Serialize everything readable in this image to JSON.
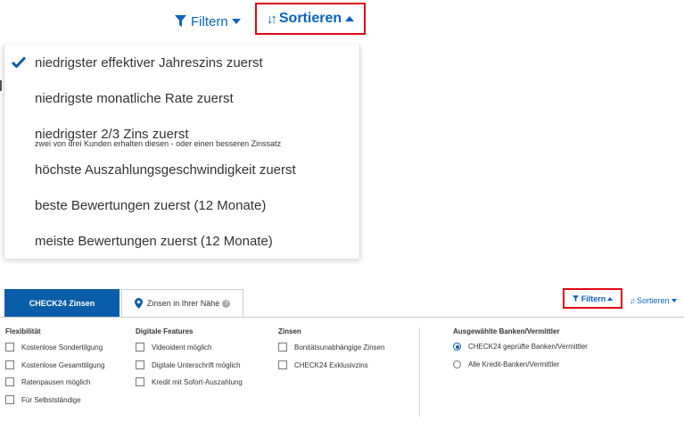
{
  "top": {
    "filter_label": "Filtern",
    "sort_label": "Sortieren",
    "options": [
      {
        "label": "niedrigster effektiver Jahreszins zuerst",
        "selected": true
      },
      {
        "label": "niedrigste monatliche Rate zuerst",
        "selected": false
      },
      {
        "label": "niedrigster 2/3 Zins zuerst",
        "sublabel": "zwei von drei Kunden erhalten diesen - oder einen besseren Zinssatz",
        "selected": false
      },
      {
        "label": "höchste Auszahlungsgeschwindigkeit zuerst",
        "selected": false
      },
      {
        "label": "beste Bewertungen zuerst (12 Monate)",
        "selected": false
      },
      {
        "label": "meiste Bewertungen zuerst (12 Monate)",
        "selected": false
      }
    ]
  },
  "bottom": {
    "tabs": [
      {
        "label": "CHECK24 Zinsen",
        "active": true
      },
      {
        "label": "Zinsen in Ihrer Nähe",
        "active": false
      }
    ],
    "help_symbol": "?",
    "filter_label": "Filtern",
    "sort_label": "Sortieren",
    "columns": [
      {
        "title": "Flexibilität",
        "items": [
          "Kostenlose Sondertilgung",
          "Kostenlose Gesamttilgung",
          "Ratenpausen möglich",
          "Für Selbstständige"
        ]
      },
      {
        "title": "Digitale Features",
        "items": [
          "Videoident möglich",
          "Digitale Unterschrift möglich",
          "Kredit mit Sofort-Auszahlung"
        ]
      },
      {
        "title": "Zinsen",
        "items": [
          "Bonitätsunabhängige Zinsen",
          "CHECK24 Exklusivzins"
        ]
      }
    ],
    "banks": {
      "title": "Ausgewählte Banken/Vermittler",
      "options": [
        {
          "label": "CHECK24 geprüfte Banken/Vermittler",
          "selected": true
        },
        {
          "label": "Alle Kredit-Banken/Vermittler",
          "selected": false
        }
      ]
    }
  },
  "colors": {
    "accent": "#0563c1",
    "highlight": "#e30613",
    "tab_active": "#0a5da8"
  }
}
